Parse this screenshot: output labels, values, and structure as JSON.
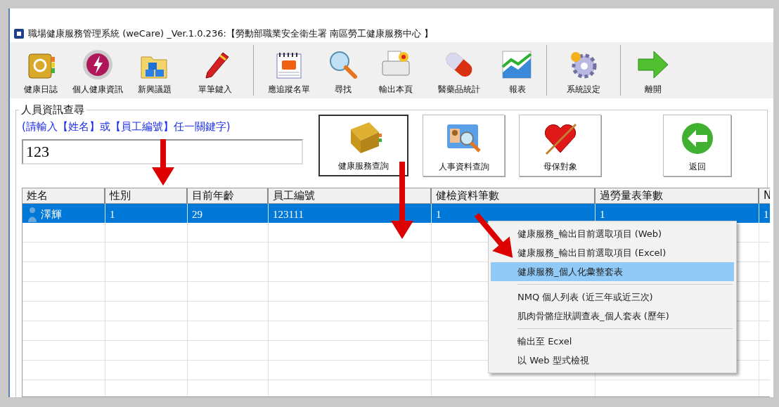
{
  "window": {
    "title": "職場健康服務管理系統 (weCare) _Ver.1.0.236:【勞動部職業安全衛生署 南區勞工健康服務中心 】"
  },
  "toolbar": [
    {
      "kind": "button",
      "label": "健康日誌"
    },
    {
      "kind": "button",
      "label": "個人健康資訊"
    },
    {
      "kind": "button",
      "label": "新興議題"
    },
    {
      "kind": "button",
      "label": "單筆鍵入"
    },
    {
      "kind": "separator"
    },
    {
      "kind": "button",
      "label": "應追蹤名單"
    },
    {
      "kind": "button",
      "label": "尋找"
    },
    {
      "kind": "button",
      "label": "輸出本頁"
    },
    {
      "kind": "button",
      "label": "醫藥品統計"
    },
    {
      "kind": "button",
      "label": "報表"
    },
    {
      "kind": "separator"
    },
    {
      "kind": "button",
      "label": "系統設定"
    },
    {
      "kind": "separator"
    },
    {
      "kind": "button",
      "label": "離開"
    }
  ],
  "search": {
    "title": "人員資訊查尋",
    "hint": "(請輸入【姓名】或【員工編號】任一關鍵字)",
    "value": "123"
  },
  "action_buttons": [
    {
      "label": "健康服務查詢",
      "selected": true
    },
    {
      "label": "人事資料查詢",
      "selected": false
    },
    {
      "label": "母保對象",
      "selected": false
    },
    {
      "label": "返回",
      "selected": false
    }
  ],
  "table": {
    "columns": [
      "姓名",
      "性別",
      "目前年齡",
      "員工編號",
      "健檢資料筆數",
      "過勞量表筆數",
      "N"
    ],
    "rows": [
      {
        "selected": true,
        "cells": [
          "澤輝",
          "1",
          "29",
          "123111",
          "1",
          "1",
          "1"
        ]
      }
    ]
  },
  "context_menu": {
    "items": [
      {
        "kind": "item",
        "label": "健康服務_輸出目前選取項目 (Web)",
        "selected": false
      },
      {
        "kind": "item",
        "label": "健康服務_輸出目前選取項目 (Excel)",
        "selected": false
      },
      {
        "kind": "item",
        "label": "健康服務_個人化彙整套表",
        "selected": true
      },
      {
        "kind": "separator"
      },
      {
        "kind": "item",
        "label": "NMQ 個人列表 (近三年或近三次)",
        "selected": false
      },
      {
        "kind": "item",
        "label": "肌肉骨骼症狀調查表_個人套表 (歷年)",
        "selected": false
      },
      {
        "kind": "separator"
      },
      {
        "kind": "item",
        "label": "輸出至 Ecxel",
        "selected": false
      },
      {
        "kind": "item",
        "label": "以 Web 型式檢視",
        "selected": false
      }
    ]
  }
}
